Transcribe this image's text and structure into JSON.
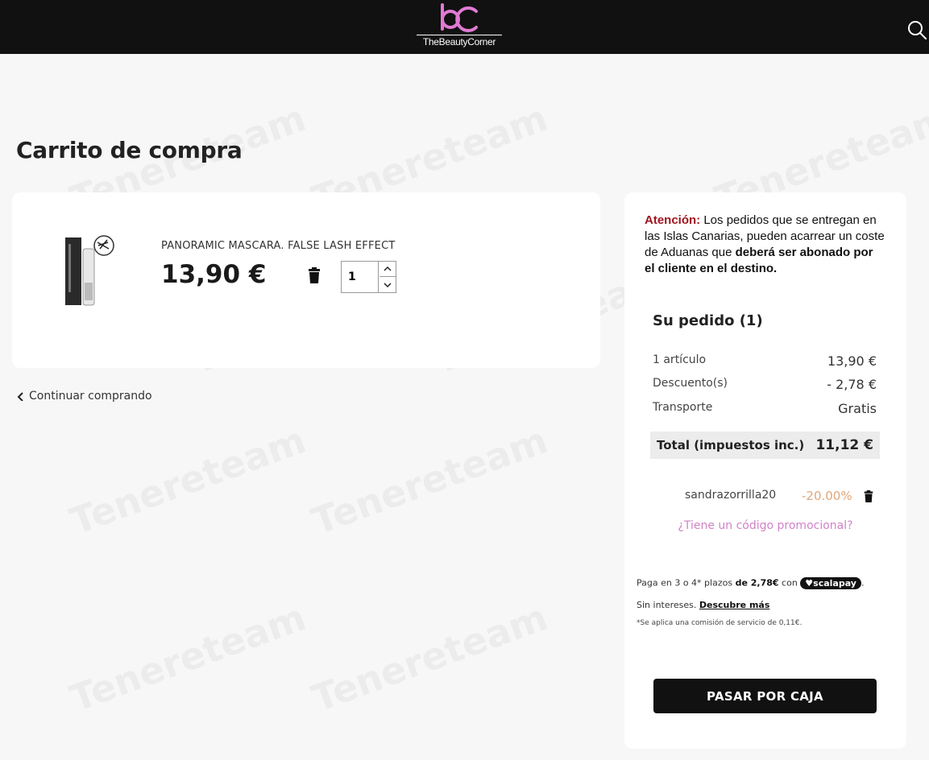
{
  "header": {
    "brand_name": "TheBeautyCorner",
    "logo_letters": "bc",
    "brand_color": "#e07ad3",
    "search_icon": "search-icon"
  },
  "page": {
    "title": "Carrito de compra"
  },
  "cart": {
    "items": [
      {
        "name": "PANORAMIC MASCARA. FALSE LASH EFFECT",
        "price": "13,90 €",
        "quantity": "1",
        "image_icon": "mascara-product-image"
      }
    ],
    "continue_label": "Continuar comprando"
  },
  "notice": {
    "label": "Atención:",
    "text_a": " Los pedidos que se entregan en las Islas Canarias, pueden acarrear un coste de Aduanas que ",
    "text_b": "deberá ser abonado por el cliente en el destino."
  },
  "summary": {
    "title": "Su pedido (1)",
    "rows": [
      {
        "label": "1 artículo",
        "value": "13,90 €"
      },
      {
        "label": "Descuento(s)",
        "value": "- 2,78 €"
      },
      {
        "label": "Transporte",
        "value": "Gratis"
      }
    ],
    "total_label": "Total (impuestos inc.)",
    "total_value": "11,12 €"
  },
  "coupon": {
    "code": "sandrazorrilla20",
    "percent": "-20.00%",
    "promo_link": "¿Tiene un código promocional?"
  },
  "scalapay": {
    "line1_a": "Paga en 3 o 4* plazos ",
    "line1_b": "de 2,78€",
    "line1_c": " con ",
    "badge": "♥scalapay",
    "line1_d": ".",
    "line2": "Sin intereses. ",
    "line2_link": "Descubre más",
    "line3": "*Se aplica una comisión de servicio de 0,11€."
  },
  "checkout": {
    "label": "PASAR POR CAJA"
  },
  "watermark_text": "Tenereteam"
}
